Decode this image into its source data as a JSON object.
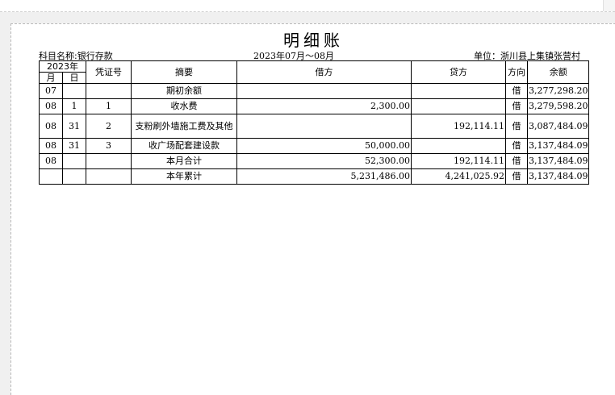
{
  "title": "明细账",
  "subject_label": "科目名称:银行存款",
  "period": "2023年07月～08月",
  "unit": "单位：浙川县上集镇张营村",
  "headers": {
    "year": "2023年",
    "month": "月",
    "day": "日",
    "voucher": "凭证号",
    "summary": "摘要",
    "debit": "借方",
    "credit": "贷方",
    "direction": "方向",
    "balance": "余额"
  },
  "rows": [
    {
      "month": "07",
      "day": "",
      "voucher": "",
      "summary": "期初余额",
      "debit": "",
      "credit": "",
      "direction": "借",
      "balance": "3,277,298.20"
    },
    {
      "month": "08",
      "day": "1",
      "voucher": "1",
      "summary": "收水费",
      "debit": "2,300.00",
      "credit": "",
      "direction": "借",
      "balance": "3,279,598.20"
    },
    {
      "month": "08",
      "day": "31",
      "voucher": "2",
      "summary": "支粉刷外墙施工费及其他",
      "debit": "",
      "credit": "192,114.11",
      "direction": "借",
      "balance": "3,087,484.09"
    },
    {
      "month": "08",
      "day": "31",
      "voucher": "3",
      "summary": "收广场配套建设款",
      "debit": "50,000.00",
      "credit": "",
      "direction": "借",
      "balance": "3,137,484.09"
    },
    {
      "month": "08",
      "day": "",
      "voucher": "",
      "summary": "本月合计",
      "debit": "52,300.00",
      "credit": "192,114.11",
      "direction": "借",
      "balance": "3,137,484.09"
    },
    {
      "month": "",
      "day": "",
      "voucher": "",
      "summary": "本年累计",
      "debit": "5,231,486.00",
      "credit": "4,241,025.92",
      "direction": "借",
      "balance": "3,137,484.09"
    }
  ]
}
